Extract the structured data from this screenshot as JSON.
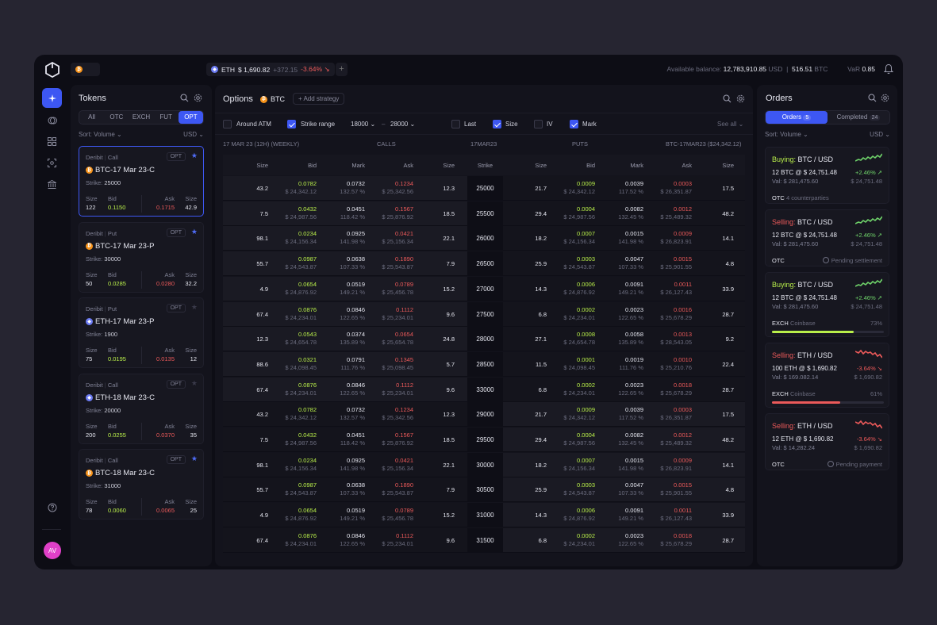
{
  "ticker": {
    "btc": "BTC",
    "eth": {
      "symbol": "ETH",
      "price": "$ 1,690.82",
      "change": "+372.15",
      "pct": "-3.64% ↘"
    },
    "add_label": "+",
    "balance_label": "Available balance:",
    "balance_usd": "12,783,910.85",
    "usd": "USD",
    "balance_btc": "516.51",
    "var_label": "VaR",
    "var_value": "0.85"
  },
  "sidebar": {
    "avatar": "AV"
  },
  "tokens": {
    "title": "Tokens",
    "tabs": [
      "All",
      "OTC",
      "EXCH",
      "FUT",
      "OPT"
    ],
    "active_tab": "OPT",
    "sort": "Sort: Volume ⌄",
    "currency": "USD ⌄",
    "cards": [
      {
        "src": "Deribit",
        "kind": "Call",
        "tag": "OPT",
        "coin": "btc",
        "name": "BTC-17 Mar 23-C",
        "strike": "25000",
        "size": "122",
        "bid": "0.1150",
        "ask": "0.1715",
        "size2": "42.9",
        "starred": true,
        "selected": true
      },
      {
        "src": "Deribit",
        "kind": "Put",
        "tag": "OPT",
        "coin": "btc",
        "name": "BTC-17 Mar 23-P",
        "strike": "30000",
        "size": "50",
        "bid": "0.0285",
        "ask": "0.0280",
        "size2": "32.2",
        "starred": true,
        "selected": false
      },
      {
        "src": "Deribit",
        "kind": "Put",
        "tag": "OPT",
        "coin": "eth",
        "name": "ETH-17 Mar 23-P",
        "strike": "1900",
        "size": "75",
        "bid": "0.0195",
        "ask": "0.0135",
        "size2": "12",
        "starred": false,
        "selected": false
      },
      {
        "src": "Deribit",
        "kind": "Call",
        "tag": "OPT",
        "coin": "eth",
        "name": "ETH-18 Mar 23-C",
        "strike": "20000",
        "size": "200",
        "bid": "0.0255",
        "ask": "0.0370",
        "size2": "35",
        "starred": false,
        "selected": false
      },
      {
        "src": "Deribit",
        "kind": "Call",
        "tag": "OPT",
        "coin": "btc",
        "name": "BTC-18 Mar 23-C",
        "strike": "31000",
        "size": "78",
        "bid": "0.0060",
        "ask": "0.0065",
        "size2": "25",
        "starred": true,
        "selected": false
      }
    ],
    "labels": {
      "size": "Size",
      "bid": "Bid",
      "ask": "Ask",
      "strike": "Strike:"
    }
  },
  "options": {
    "title": "Options",
    "coin": "BTC",
    "add_strategy": "+ Add strategy",
    "filters": {
      "around_atm": "Around ATM",
      "strike_range": "Strike range",
      "from": "18000 ⌄",
      "to": "28000 ⌄",
      "dash": "–",
      "last": "Last",
      "size": "Size",
      "iv": "IV",
      "mark": "Mark",
      "see_all": "See all ⌄"
    },
    "expiry": "17 MAR 23 (12H) (WEEKLY)",
    "calls": "CALLS",
    "date": "17MAR23",
    "puts": "PUTS",
    "code": "BTC-17MAR23 ($24,342.12)",
    "columns": [
      "Size",
      "Bid",
      "Mark",
      "Ask",
      "Size",
      "Strike",
      "Size",
      "Bid",
      "Mark",
      "Ask",
      "Size"
    ],
    "rows": [
      {
        "cs": "43.2",
        "cb": "0.0782",
        "cbu": "$ 24,342.12",
        "cm": "0.0732",
        "cmp": "132.57 %",
        "ca": "0.1234",
        "cau": "$ 25,342.56",
        "cs2": "12.3",
        "k": "25000",
        "ps": "21.7",
        "pb": "0.0009",
        "pbu": "$ 24,342.12",
        "pm": "0.0039",
        "pmp": "117.52 %",
        "pa": "0.0003",
        "pau": "$ 26,351.87",
        "ps2": "17.5"
      },
      {
        "cs": "7.5",
        "cb": "0.0432",
        "cbu": "$ 24,987.56",
        "cm": "0.0451",
        "cmp": "118.42 %",
        "ca": "0.1567",
        "cau": "$ 25,876.92",
        "cs2": "18.5",
        "k": "25500",
        "ps": "29.4",
        "pb": "0.0004",
        "pbu": "$ 24,987.56",
        "pm": "0.0082",
        "pmp": "132.45 %",
        "pa": "0.0012",
        "pau": "$ 25,489.32",
        "ps2": "48.2"
      },
      {
        "cs": "98.1",
        "cb": "0.0234",
        "cbu": "$ 24,156.34",
        "cm": "0.0925",
        "cmp": "141.98 %",
        "ca": "0.0421",
        "cau": "$ 25,156.34",
        "cs2": "22.1",
        "k": "26000",
        "ps": "18.2",
        "pb": "0.0007",
        "pbu": "$ 24,156.34",
        "pm": "0.0015",
        "pmp": "141.98 %",
        "pa": "0.0009",
        "pau": "$ 26,823.91",
        "ps2": "14.1"
      },
      {
        "cs": "55.7",
        "cb": "0.0987",
        "cbu": "$ 24,543.87",
        "cm": "0.0638",
        "cmp": "107.33 %",
        "ca": "0.1890",
        "cau": "$ 25,543.87",
        "cs2": "7.9",
        "k": "26500",
        "ps": "25.9",
        "pb": "0.0003",
        "pbu": "$ 24,543.87",
        "pm": "0.0047",
        "pmp": "107.33 %",
        "pa": "0.0015",
        "pau": "$ 25,901.55",
        "ps2": "4.8"
      },
      {
        "cs": "4.9",
        "cb": "0.0654",
        "cbu": "$ 24,876.92",
        "cm": "0.0519",
        "cmp": "149.21 %",
        "ca": "0.0789",
        "cau": "$ 25,456.78",
        "cs2": "15.2",
        "k": "27000",
        "ps": "14.3",
        "pb": "0.0006",
        "pbu": "$ 24,876.92",
        "pm": "0.0091",
        "pmp": "149.21 %",
        "pa": "0.0011",
        "pau": "$ 26,127.43",
        "ps2": "33.9"
      },
      {
        "cs": "67.4",
        "cb": "0.0876",
        "cbu": "$ 24,234.01",
        "cm": "0.0846",
        "cmp": "122.65 %",
        "ca": "0.1112",
        "cau": "$ 25,234.01",
        "cs2": "9.6",
        "k": "27500",
        "ps": "6.8",
        "pb": "0.0002",
        "pbu": "$ 24,234.01",
        "pm": "0.0023",
        "pmp": "122.65 %",
        "pa": "0.0016",
        "pau": "$ 25,678.29",
        "ps2": "28.7"
      },
      {
        "cs": "12.3",
        "cb": "0.0543",
        "cbu": "$ 24,654.78",
        "cm": "0.0374",
        "cmp": "135.89 %",
        "ca": "0.0654",
        "cau": "$ 25,654.78",
        "cs2": "24.8",
        "k": "28000",
        "ps": "27.1",
        "pb": "0.0008",
        "pbu": "$ 24,654.78",
        "pm": "0.0058",
        "pmp": "135.89 %",
        "pa": "0.0013",
        "pau": "$ 28,543.05",
        "ps2": "9.2"
      },
      {
        "cs": "88.6",
        "cb": "0.0321",
        "cbu": "$ 24,098.45",
        "cm": "0.0791",
        "cmp": "111.76 %",
        "ca": "0.1345",
        "cau": "$ 25,098.45",
        "cs2": "5.7",
        "k": "28500",
        "ps": "11.5",
        "pb": "0.0001",
        "pbu": "$ 24,098.45",
        "pm": "0.0019",
        "pmp": "111.76 %",
        "pa": "0.0010",
        "pau": "$ 25,210.76",
        "ps2": "22.4"
      },
      {
        "cs": "67.4",
        "cb": "0.0876",
        "cbu": "$ 24,234.01",
        "cm": "0.0846",
        "cmp": "122.65 %",
        "ca": "0.1112",
        "cau": "$ 25,234.01",
        "cs2": "9.6",
        "k": "33000",
        "ps": "6.8",
        "pb": "0.0002",
        "pbu": "$ 24,234.01",
        "pm": "0.0023",
        "pmp": "122.65 %",
        "pa": "0.0018",
        "pau": "$ 25,678.29",
        "ps2": "28.7"
      },
      {
        "cs": "43.2",
        "cb": "0.0782",
        "cbu": "$ 24,342.12",
        "cm": "0.0732",
        "cmp": "132.57 %",
        "ca": "0.1234",
        "cau": "$ 25,342.56",
        "cs2": "12.3",
        "k": "29000",
        "ps": "21.7",
        "pb": "0.0009",
        "pbu": "$ 24,342.12",
        "pm": "0.0039",
        "pmp": "117.52 %",
        "pa": "0.0003",
        "pau": "$ 26,351.87",
        "ps2": "17.5"
      },
      {
        "cs": "7.5",
        "cb": "0.0432",
        "cbu": "$ 24,987.56",
        "cm": "0.0451",
        "cmp": "118.42 %",
        "ca": "0.1567",
        "cau": "$ 25,876.92",
        "cs2": "18.5",
        "k": "29500",
        "ps": "29.4",
        "pb": "0.0004",
        "pbu": "$ 24,987.56",
        "pm": "0.0082",
        "pmp": "132.45 %",
        "pa": "0.0012",
        "pau": "$ 25,489.32",
        "ps2": "48.2"
      },
      {
        "cs": "98.1",
        "cb": "0.0234",
        "cbu": "$ 24,156.34",
        "cm": "0.0925",
        "cmp": "141.98 %",
        "ca": "0.0421",
        "cau": "$ 25,156.34",
        "cs2": "22.1",
        "k": "30000",
        "ps": "18.2",
        "pb": "0.0007",
        "pbu": "$ 24,156.34",
        "pm": "0.0015",
        "pmp": "141.98 %",
        "pa": "0.0009",
        "pau": "$ 26,823.91",
        "ps2": "14.1"
      },
      {
        "cs": "55.7",
        "cb": "0.0987",
        "cbu": "$ 24,543.87",
        "cm": "0.0638",
        "cmp": "107.33 %",
        "ca": "0.1890",
        "cau": "$ 25,543.87",
        "cs2": "7.9",
        "k": "30500",
        "ps": "25.9",
        "pb": "0.0003",
        "pbu": "$ 24,543.87",
        "pm": "0.0047",
        "pmp": "107.33 %",
        "pa": "0.0015",
        "pau": "$ 25,901.55",
        "ps2": "4.8"
      },
      {
        "cs": "4.9",
        "cb": "0.0654",
        "cbu": "$ 24,876.92",
        "cm": "0.0519",
        "cmp": "149.21 %",
        "ca": "0.0789",
        "cau": "$ 25,456.78",
        "cs2": "15.2",
        "k": "31000",
        "ps": "14.3",
        "pb": "0.0006",
        "pbu": "$ 24,876.92",
        "pm": "0.0091",
        "pmp": "149.21 %",
        "pa": "0.0011",
        "pau": "$ 26,127.43",
        "ps2": "33.9"
      },
      {
        "cs": "67.4",
        "cb": "0.0876",
        "cbu": "$ 24,234.01",
        "cm": "0.0846",
        "cmp": "122.65 %",
        "ca": "0.1112",
        "cau": "$ 25,234.01",
        "cs2": "9.6",
        "k": "31500",
        "ps": "6.8",
        "pb": "0.0002",
        "pbu": "$ 24,234.01",
        "pm": "0.0023",
        "pmp": "122.65 %",
        "pa": "0.0018",
        "pau": "$ 25,678.29",
        "ps2": "28.7"
      }
    ]
  },
  "orders": {
    "title": "Orders",
    "tab_orders": "Orders",
    "tab_orders_count": "5",
    "tab_completed": "Completed",
    "tab_completed_count": "24",
    "sort": "Sort: Volume ⌄",
    "currency": "USD ⌄",
    "items": [
      {
        "side": "Buying:",
        "pair": "BTC / USD",
        "qty": "12 BTC @ $ 24,751.48",
        "val": "Val: $ 281,475.60",
        "pct": "+2.46% ↗",
        "price": "$ 24,751.48",
        "venue": "OTC",
        "note": "4 counterparties",
        "status": "",
        "progress": null,
        "up": true,
        "color": "#6fd36a"
      },
      {
        "side": "Selling:",
        "pair": "BTC / USD",
        "qty": "12 BTC @ $ 24,751.48",
        "val": "Val: $ 281,475.60",
        "pct": "+2.46% ↗",
        "price": "$ 24,751.48",
        "venue": "OTC",
        "note": "",
        "status": "Pending settlement",
        "progress": null,
        "up": true,
        "color": "#6fd36a"
      },
      {
        "side": "Buying:",
        "pair": "BTC / USD",
        "qty": "12 BTC @ $ 24,751.48",
        "val": "Val: $ 281,475.60",
        "pct": "+2.46% ↗",
        "price": "$ 24,751.48",
        "venue": "EXCH",
        "note": "Coinbase",
        "status": "73%",
        "progress": 73,
        "up": true,
        "color": "#b9ef4a"
      },
      {
        "side": "Selling:",
        "pair": "ETH / USD",
        "qty": "100 ETH @ $ 1,690.82",
        "val": "Val: $ 169.082.14",
        "pct": "-3.64% ↘",
        "price": "$ 1,690.82",
        "venue": "EXCH",
        "note": "Coinbase",
        "status": "61%",
        "progress": 61,
        "up": false,
        "color": "#ec5a5a"
      },
      {
        "side": "Selling:",
        "pair": "ETH / USD",
        "qty": "12 ETH @ $ 1,690.82",
        "val": "Val: $ 14,282.24",
        "pct": "-3.64% ↘",
        "price": "$ 1,690.82",
        "venue": "OTC",
        "note": "",
        "status": "Pending payment",
        "progress": null,
        "up": false,
        "color": "#ec5a5a"
      }
    ]
  },
  "colors": {
    "accent": "#3d57f3",
    "green": "#6fd36a",
    "red": "#ec5a5a",
    "lime": "#b9ef4a"
  }
}
